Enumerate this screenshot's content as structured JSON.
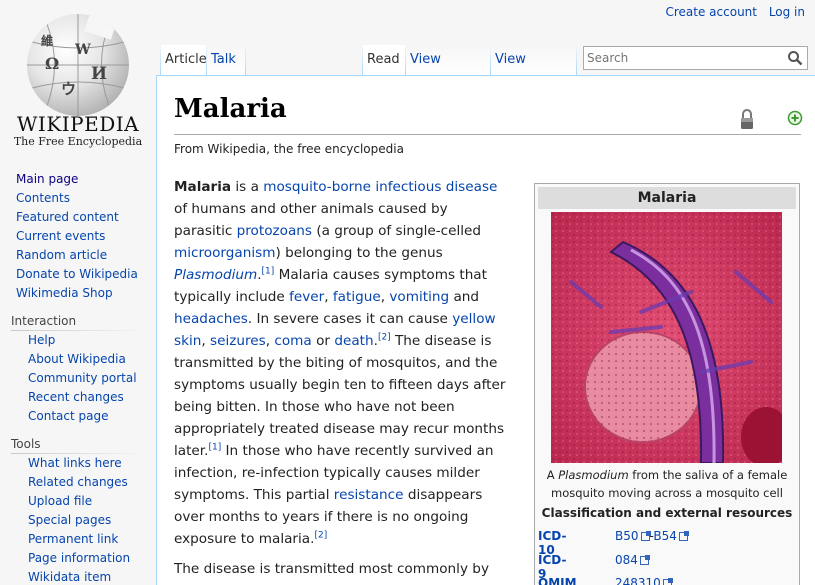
{
  "logo": {
    "wordmark": "WIKIPEDIA",
    "tagline": "The Free Encyclopedia",
    "globe_glyphs": [
      "Ω",
      "W",
      "И",
      "ウ",
      "維"
    ]
  },
  "personal": {
    "create_account": "Create account",
    "login": "Log in"
  },
  "tabs": {
    "article": "Article",
    "talk": "Talk",
    "read": "Read",
    "view_source": "View source",
    "view_history": "View history"
  },
  "search": {
    "placeholder": "Search"
  },
  "sidebar": {
    "nav": [
      "Main page",
      "Contents",
      "Featured content",
      "Current events",
      "Random article",
      "Donate to Wikipedia",
      "Wikimedia Shop"
    ],
    "interaction": {
      "heading": "Interaction",
      "items": [
        "Help",
        "About Wikipedia",
        "Community portal",
        "Recent changes",
        "Contact page"
      ]
    },
    "tools": {
      "heading": "Tools",
      "items": [
        "What links here",
        "Related changes",
        "Upload file",
        "Special pages",
        "Permanent link",
        "Page information",
        "Wikidata item"
      ]
    }
  },
  "page": {
    "title": "Malaria",
    "sitesub": "From Wikipedia, the free encyclopedia",
    "p1": {
      "t01": "Malaria",
      "t02": " is a ",
      "t03": "mosquito-borne",
      "t04": " ",
      "t05": "infectious disease",
      "t06": " of humans and other animals caused by parasitic ",
      "t07": "protozoans",
      "t08": " (a group of single-celled ",
      "t09": "microorganism",
      "t10": ") belonging to the genus ",
      "t11": "Plasmodium",
      "t12": ".",
      "t13": "[1]",
      "t14": " Malaria causes symptoms that typically include ",
      "t15": "fever",
      "t16": ", ",
      "t17": "fatigue",
      "t18": ", ",
      "t19": "vomiting",
      "t20": " and ",
      "t21": "headaches",
      "t22": ". In severe cases it can cause ",
      "t23": "yellow skin",
      "t24": ", ",
      "t25": "seizures",
      "t26": ", ",
      "t27": "coma",
      "t28": " or ",
      "t29": "death",
      "t30": ".",
      "t31": "[2]",
      "t32": " The disease is transmitted by the biting of mosquitos, and the symptoms usually begin ten to fifteen days after being bitten. In those who have not been appropriately treated disease may recur months later.",
      "t33": "[1]",
      "t34": " In those who have recently survived an infection, re-infection typically causes milder symptoms. This partial ",
      "t35": "resistance",
      "t36": " disappears over months to years if there is no ongoing exposure to malaria.",
      "t37": "[2]"
    },
    "p2": "The disease is transmitted most commonly by an"
  },
  "infobox": {
    "title": "Malaria",
    "caption_pre": "A ",
    "caption_em": "Plasmodium",
    "caption_post": " from the saliva of a female mosquito moving across a mosquito cell",
    "classification": "Classification and external resources",
    "rows": [
      {
        "key": "ICD-10",
        "v1": "B50",
        "sep": "-",
        "v2": "B54"
      },
      {
        "key": "ICD-9",
        "v1": "084"
      },
      {
        "key": "OMIM",
        "v1": "248310"
      }
    ]
  },
  "colors": {
    "link": "#0645ad",
    "border": "#a7d7f9",
    "image": "#d8375f"
  }
}
